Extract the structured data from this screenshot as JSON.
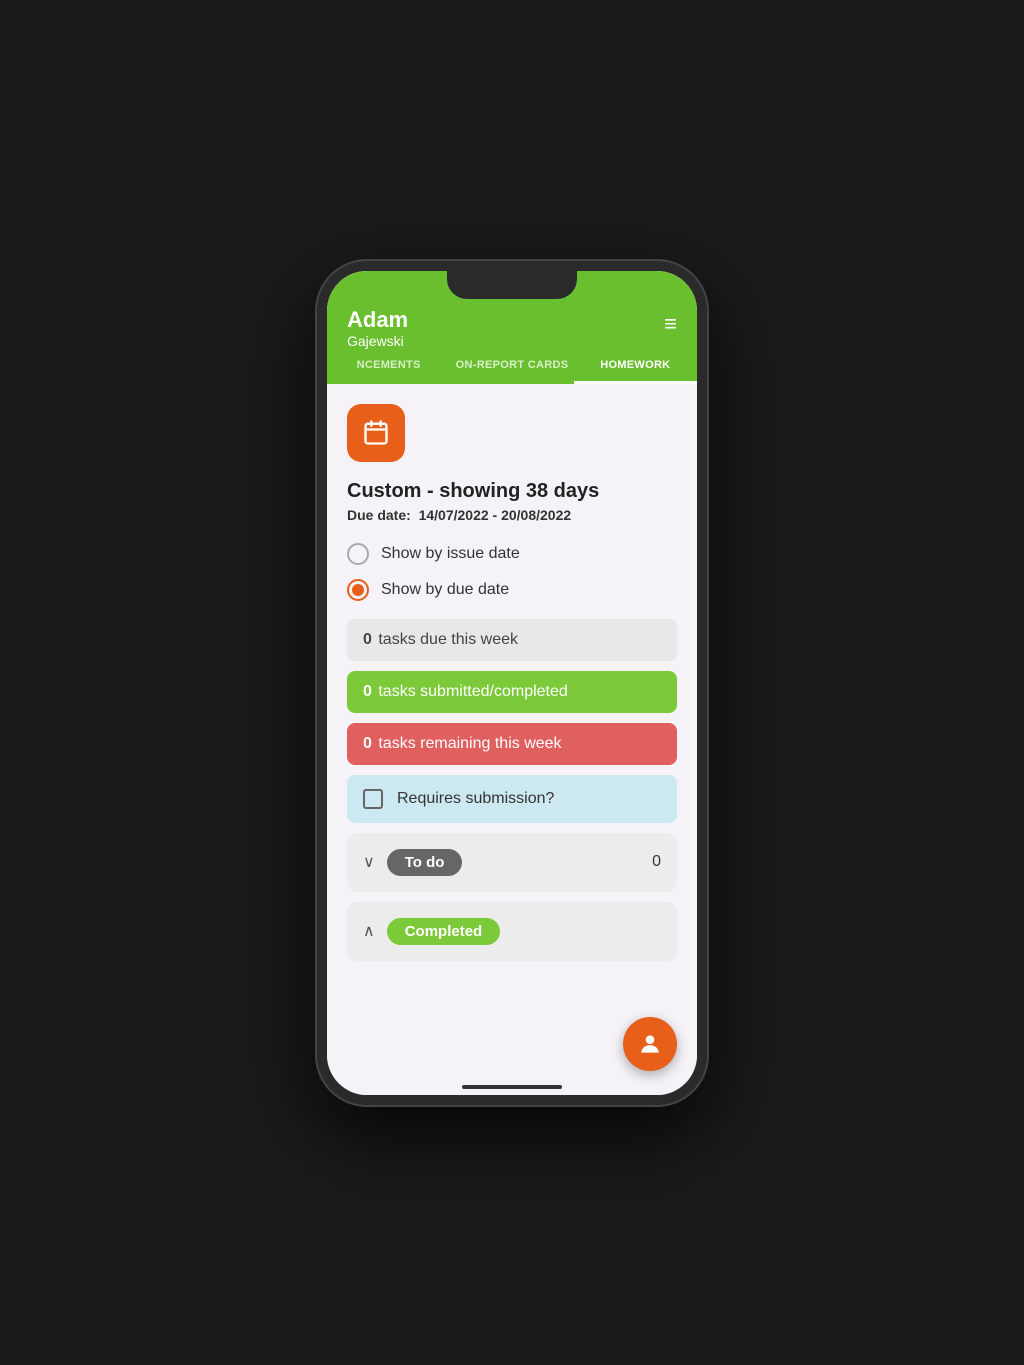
{
  "header": {
    "name": "Adam",
    "surname": "Gajewski",
    "hamburger": "≡"
  },
  "tabs": [
    {
      "label": "NCEMENTS",
      "active": false
    },
    {
      "label": "ON-REPORT CARDS",
      "active": false
    },
    {
      "label": "HOMEWORK",
      "active": true
    }
  ],
  "calendar_button_label": "📅",
  "date_range": {
    "title": "Custom - showing 38 days",
    "subtitle_label": "Due date:",
    "subtitle_value": "14/07/2022 - 20/08/2022"
  },
  "radio_options": [
    {
      "label": "Show by issue date",
      "selected": false
    },
    {
      "label": "Show by due date",
      "selected": true
    }
  ],
  "task_bars": [
    {
      "count": "0",
      "label": "tasks due this week",
      "style": "neutral"
    },
    {
      "count": "0",
      "label": "tasks submitted/completed",
      "style": "green"
    },
    {
      "count": "0",
      "label": "tasks remaining this week",
      "style": "red"
    }
  ],
  "submission": {
    "label": "Requires submission?"
  },
  "sections": [
    {
      "chevron": "∨",
      "badge": "To do",
      "badge_style": "grey",
      "count": "0"
    },
    {
      "chevron": "∧",
      "badge": "Completed",
      "badge_style": "green",
      "count": ""
    }
  ],
  "fab": {
    "icon": "👤"
  }
}
